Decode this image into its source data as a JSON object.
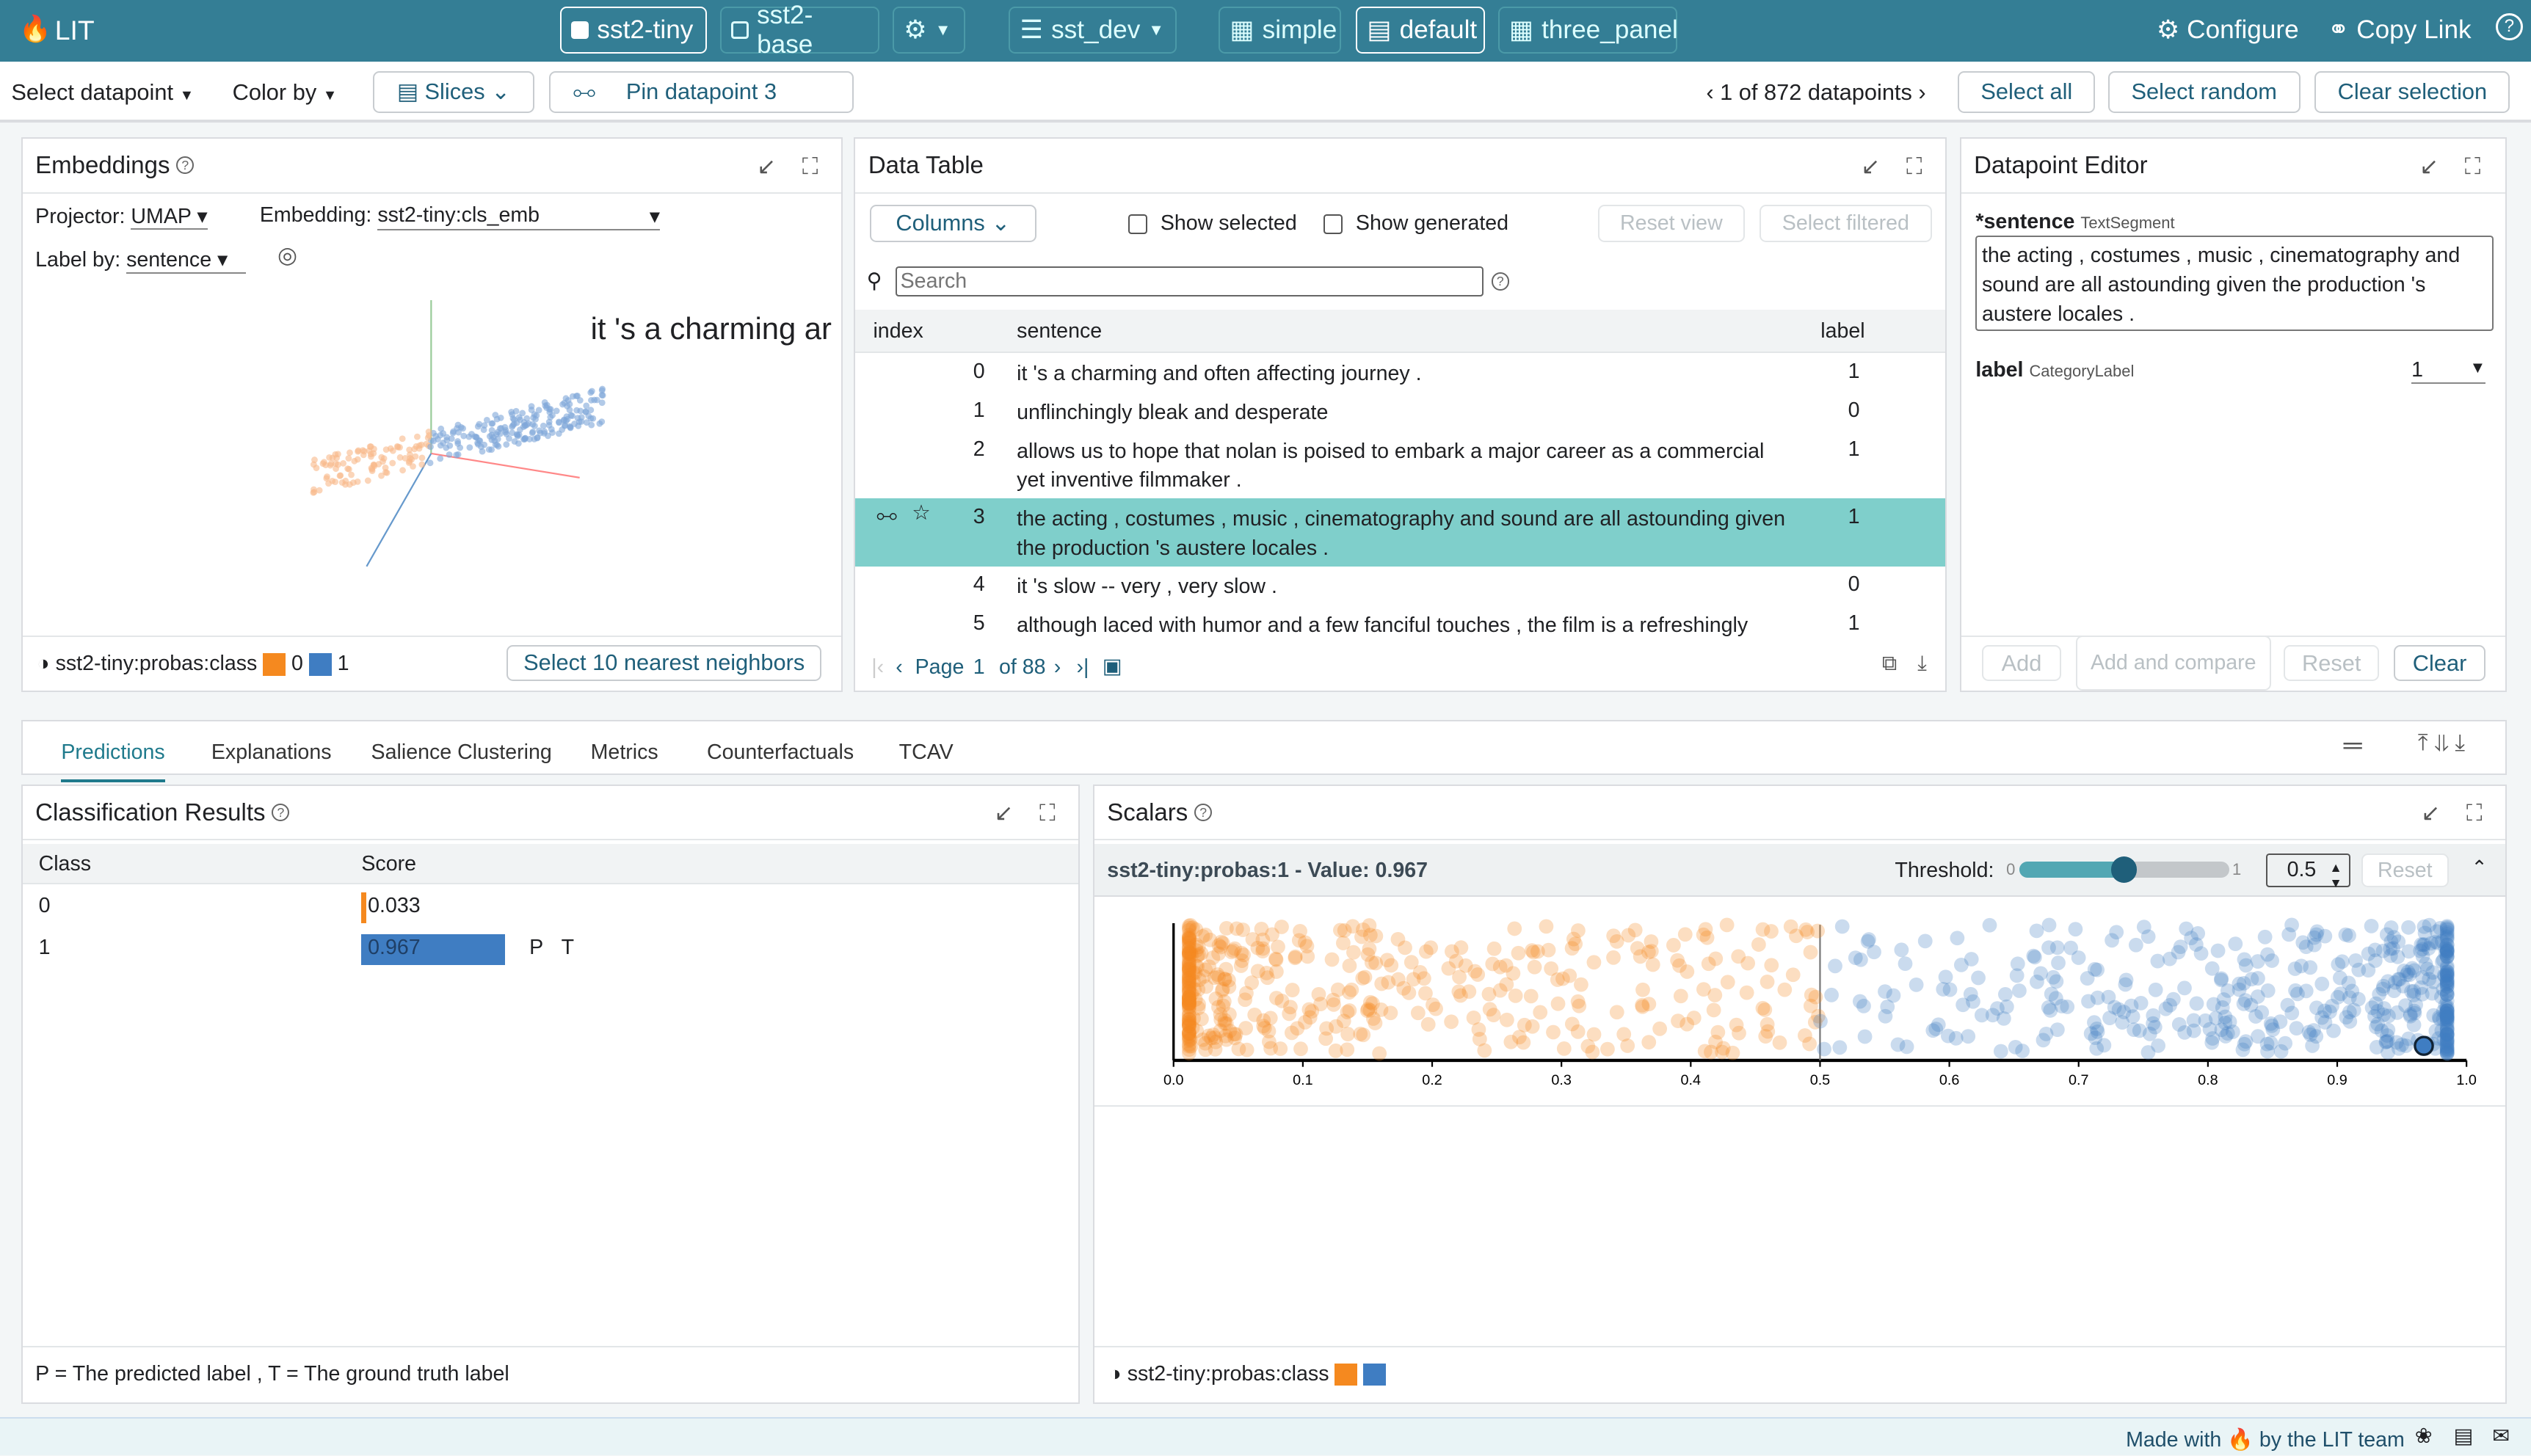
{
  "app": {
    "title": "LIT"
  },
  "topbar": {
    "models": [
      {
        "label": "sst2-tiny",
        "selected": true
      },
      {
        "label": "sst2-base",
        "selected": false
      }
    ],
    "dataset": "sst_dev",
    "layouts": [
      {
        "label": "simple",
        "selected": false
      },
      {
        "label": "default",
        "selected": true
      },
      {
        "label": "three_panel",
        "selected": false
      }
    ],
    "configure": "Configure",
    "copy_link": "Copy Link"
  },
  "toolbar": {
    "select_datapoint": "Select datapoint",
    "color_by": "Color by",
    "slices": "Slices",
    "pin": "Pin datapoint 3",
    "nav": "1 of 872 datapoints",
    "select_all": "Select all",
    "select_random": "Select random",
    "clear_selection": "Clear selection"
  },
  "embeddings": {
    "title": "Embeddings",
    "projector_label": "Projector:",
    "projector": "UMAP",
    "embedding_label": "Embedding:",
    "embedding": "sst2-tiny:cls_emb",
    "label_by_label": "Label by:",
    "label_by": "sentence",
    "hover_text": "it 's a charming ar",
    "legend_field": "sst2-tiny:probas:class",
    "legend": [
      {
        "label": "0",
        "color": "#f5891f"
      },
      {
        "label": "1",
        "color": "#3f7dc2"
      }
    ],
    "nn_button": "Select 10 nearest neighbors"
  },
  "data_table": {
    "title": "Data Table",
    "columns_btn": "Columns",
    "show_selected": "Show selected",
    "show_generated": "Show generated",
    "reset_view": "Reset view",
    "select_filtered": "Select filtered",
    "search_placeholder": "Search",
    "headers": [
      "index",
      "sentence",
      "label"
    ],
    "rows": [
      {
        "index": "0",
        "sentence": "it 's a charming and often affecting journey .",
        "label": "1"
      },
      {
        "index": "1",
        "sentence": "unflinchingly bleak and desperate",
        "label": "0"
      },
      {
        "index": "2",
        "sentence": "allows us to hope that nolan is poised to embark a major career as a commercial yet inventive filmmaker .",
        "label": "1"
      },
      {
        "index": "3",
        "sentence": "the acting , costumes , music , cinematography and sound are all astounding given the production 's austere locales .",
        "label": "1",
        "selected": true
      },
      {
        "index": "4",
        "sentence": "it 's slow -- very , very slow .",
        "label": "0"
      },
      {
        "index": "5",
        "sentence": "although laced with humor and a few fanciful touches , the film is a refreshingly",
        "label": "1"
      }
    ],
    "page_label": "Page",
    "page": "1",
    "page_of": "of 88"
  },
  "editor": {
    "title": "Datapoint Editor",
    "sentence_label": "*sentence",
    "sentence_type": "TextSegment",
    "sentence": "the acting , costumes , music , cinematography and sound are all astounding given the production 's austere locales .",
    "label_label": "label",
    "label_type": "CategoryLabel",
    "label_value": "1",
    "add": "Add",
    "add_compare": "Add and compare",
    "reset": "Reset",
    "clear": "Clear"
  },
  "tabs": [
    "Predictions",
    "Explanations",
    "Salience Clustering",
    "Metrics",
    "Counterfactuals",
    "TCAV"
  ],
  "classification": {
    "title": "Classification Results",
    "headers": [
      "Class",
      "Score"
    ],
    "rows": [
      {
        "class": "0",
        "score": "0.033",
        "value": 0.033,
        "color": "#f5891f",
        "marks": ""
      },
      {
        "class": "1",
        "score": "0.967",
        "value": 0.967,
        "color": "#3f7dc2",
        "marks": "P T"
      }
    ],
    "footer": "P = The predicted label , T = The ground truth label"
  },
  "scalars": {
    "title": "Scalars",
    "field_title": "sst2-tiny:probas:1 - Value: 0.967",
    "threshold_label": "Threshold:",
    "slider_min": "0",
    "slider_max": "1",
    "threshold": "0.5",
    "threshold_value": 0.5,
    "reset": "Reset",
    "legend_field": "sst2-tiny:probas:class"
  },
  "chart_data": {
    "type": "scatter",
    "xlim": [
      0,
      1
    ],
    "x_ticks": [
      "0.0",
      "0.1",
      "0.2",
      "0.3",
      "0.4",
      "0.5",
      "0.6",
      "0.7",
      "0.8",
      "0.9",
      "1.0"
    ],
    "threshold": 0.5,
    "selected_point": 0.967,
    "series": [
      {
        "name": "0",
        "color": "#f5891f"
      },
      {
        "name": "1",
        "color": "#3f7dc2"
      }
    ]
  },
  "footer": {
    "made_with": "Made with",
    "by": "by the LIT team"
  }
}
